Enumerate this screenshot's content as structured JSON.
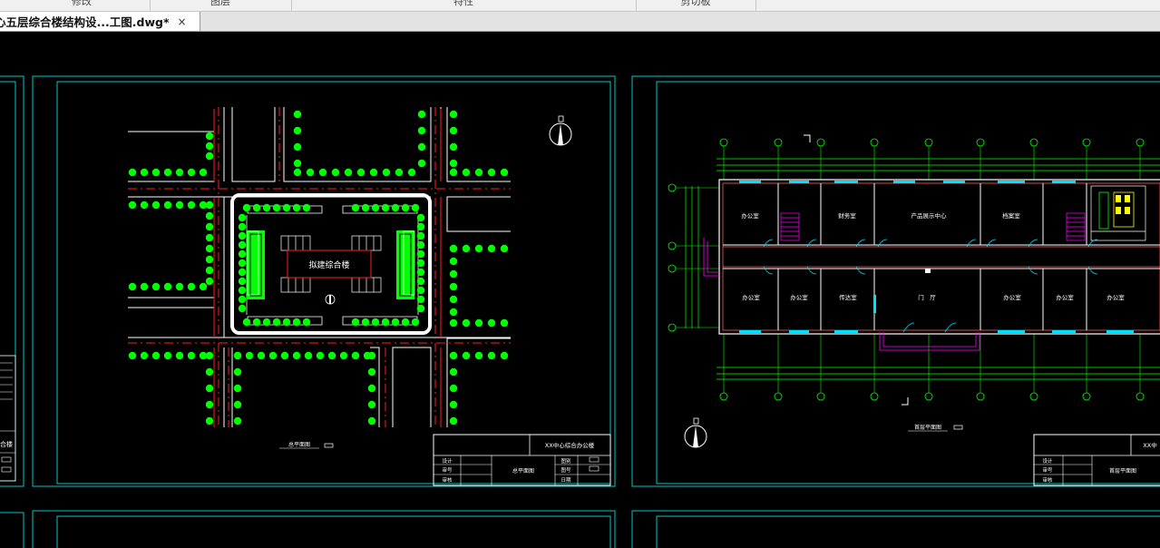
{
  "ribbon": {
    "panels": [
      "修改",
      "图层",
      "特性",
      "剪切板"
    ]
  },
  "document_tab": {
    "title": "心五层综合楼结构设...工图.dwg*",
    "close_glyph": "×"
  },
  "sheet_left": {
    "building_label": "拟建综合楼",
    "drawing_title": "总平面图",
    "title_block": {
      "project": "XX中心综合办公楼",
      "drawing_name": "总平面图",
      "row_labels": [
        "设计",
        "审号",
        "审核"
      ],
      "right_labels": [
        "图别",
        "图号",
        "日期"
      ]
    }
  },
  "sheet_right": {
    "drawing_title": "首层平面图",
    "rooms_top": [
      "办公室",
      "财务室",
      "产品展示中心",
      "档案室"
    ],
    "rooms_bottom": [
      "办公室",
      "办公室",
      "传达室",
      "门　厅",
      "办公室",
      "办公室",
      "办公室"
    ],
    "title_block": {
      "project_partial": "XX中",
      "drawing_name": "首层平面图",
      "row_labels": [
        "设计",
        "审号",
        "审核"
      ]
    }
  },
  "sheet_far_left": {
    "partial_label": "合楼"
  },
  "colors": {
    "frame": "#00c8c8",
    "tree": "#00ff00",
    "road_center": "#ff2020",
    "wall": "#ffffff",
    "wall_inner": "#ff6060",
    "window": "#00e0ff",
    "magenta": "#ff00ff",
    "yellow": "#ffff00",
    "grid_line": "#00ff00",
    "text": "#ffffff"
  }
}
